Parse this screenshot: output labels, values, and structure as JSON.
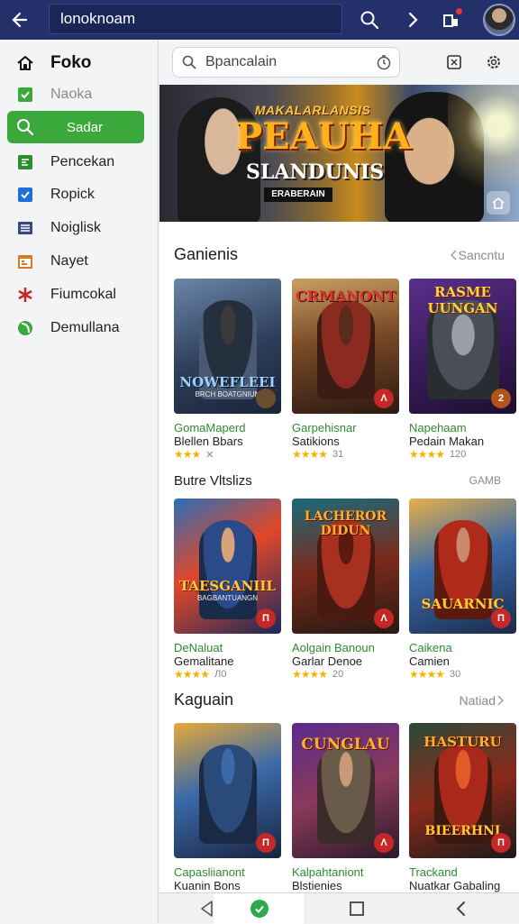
{
  "topbar": {
    "url_text": "lonoknoam"
  },
  "sidebar": {
    "items": [
      {
        "label": "Foko",
        "icon": "home-icon"
      },
      {
        "label": "Naoka",
        "icon": "checkbox-icon"
      },
      {
        "label": "Sadar",
        "icon": "search-icon"
      },
      {
        "label": "Pencekan",
        "icon": "grid-icon"
      },
      {
        "label": "Ropick",
        "icon": "check-square-icon"
      },
      {
        "label": "Noiglisk",
        "icon": "list-icon"
      },
      {
        "label": "Nayet",
        "icon": "calendar-icon"
      },
      {
        "label": "Fiumcokal",
        "icon": "asterisk-icon"
      },
      {
        "label": "Demullana",
        "icon": "leaf-icon"
      }
    ]
  },
  "search": {
    "placeholder": "Bpancalain"
  },
  "hero": {
    "line1": "MAKALARLANSIS",
    "line2": "PEAUHA",
    "line3": "SLANDUNIS",
    "line4": "ERABERAIN"
  },
  "sections": [
    {
      "title": "Ganienis",
      "link": "Sancntu",
      "cards": [
        {
          "thumb_title": "NOWEFLEEI",
          "thumb_sub": "BRCH BOATGNIUN",
          "pill": "",
          "name": "GomaMaperd",
          "sub": "Blellen Bbars",
          "stars": "★★★",
          "meta": "✕"
        },
        {
          "thumb_title": "CRMANONT",
          "thumb_sub": "",
          "pill": "Λ",
          "name": "Garpehisnar",
          "sub": "Satikions",
          "stars": "★★★★",
          "meta": "31"
        },
        {
          "thumb_title": "RASME UUNGAN",
          "thumb_sub": "",
          "pill": "2",
          "name": "Napehaam",
          "sub": "Pedain Makan",
          "stars": "★★★★",
          "meta": "120"
        }
      ]
    },
    {
      "title": "Butre Vltslizs",
      "link": "GAMB",
      "cards": [
        {
          "thumb_title": "TAESGANIIL",
          "thumb_sub": "BAGBANTUANGN",
          "pill": "Π",
          "name": "DeNaluat",
          "sub": "Gemalitane",
          "stars": "★★★★",
          "meta": "Л0"
        },
        {
          "thumb_title": "LACHEROR DIDUN",
          "thumb_sub": "",
          "pill": "Λ",
          "name": "Aolgain Banoun",
          "sub": "Garlar Denoe",
          "stars": "★★★★",
          "meta": "20"
        },
        {
          "thumb_title": "SAUARNIC",
          "thumb_sub": "",
          "pill": "Π",
          "name": "Caikena",
          "sub": "Camien",
          "stars": "★★★★",
          "meta": "30"
        }
      ]
    },
    {
      "title": "Kaguain",
      "link": "Natiad",
      "cards": [
        {
          "thumb_title": "",
          "thumb_sub": "",
          "pill": "Π",
          "name": "Capasliianont",
          "sub": "Kuanin Bons",
          "stars": "",
          "meta": ""
        },
        {
          "thumb_title": "CUNGLAU",
          "thumb_sub": "",
          "pill": "Λ",
          "name": "Kalpahtaniont",
          "sub": "Blstienies",
          "stars": "",
          "meta": ""
        },
        {
          "thumb_title": "HASTURU",
          "thumb_sub": "BIEERHNI",
          "pill": "Π",
          "name": "Trackand",
          "sub": "Nuatkar Gabaling",
          "stars": "",
          "meta": ""
        }
      ]
    }
  ],
  "colors": {
    "topbar": "#23306a",
    "accent_green": "#3aa83a",
    "card_name_green": "#2e8b2e",
    "star": "#f4b400",
    "pill_red": "#c62828"
  }
}
